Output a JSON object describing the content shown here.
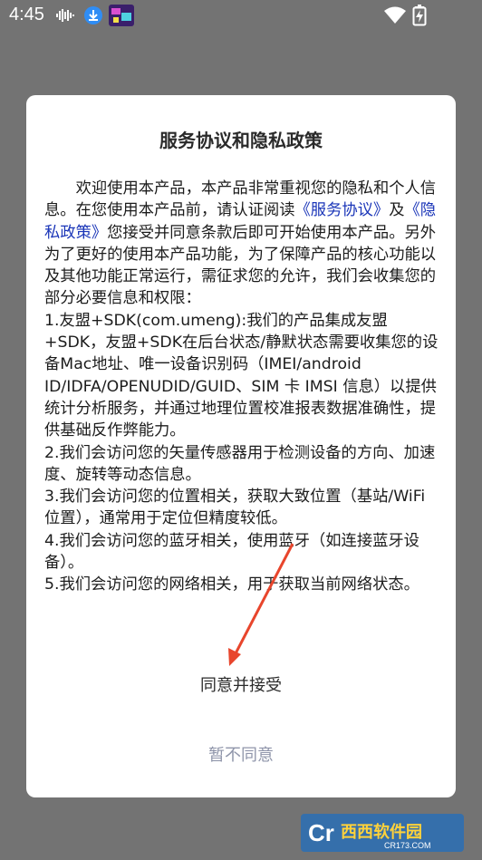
{
  "status_bar": {
    "time": "4:45",
    "icons": [
      "wave-icon",
      "download-icon",
      "app-thumbnail-icon",
      "wifi-icon",
      "battery-icon"
    ]
  },
  "dialog": {
    "title": "服务协议和隐私政策",
    "intro_pre": "欢迎使用本产品，本产品非常重视您的隐私和个人信息。在您使用本产品前，请认证阅读",
    "service_link": "《服务协议》",
    "and_text": "及",
    "privacy_link": "《隐私政策》",
    "intro_post": "您接受并同意条款后即可开始使用本产品。另外为了更好的使用本产品功能，为了保障产品的核心功能以及其他功能正常运行，需征求您的允许，我们会收集您的部分必要信息和权限：",
    "items": [
      "1.友盟+SDK(com.umeng):我们的产品集成友盟+SDK，友盟+SDK在后台状态/静默状态需要收集您的设备Mac地址、唯一设备识别码（IMEI/android ID/IDFA/OPENUDID/GUID、SIM 卡 IMSI 信息）以提供统计分析服务，并通过地理位置校准报表数据准确性，提供基础反作弊能力。",
      "2.我们会访问您的矢量传感器用于检测设备的方向、加速度、旋转等动态信息。",
      "3.我们会访问您的位置相关，获取大致位置（基站/WiFi 位置），通常用于定位但精度较低。",
      "4.我们会访问您的蓝牙相关，使用蓝牙（如连接蓝牙设备）。",
      "5.我们会访问您的网络相关，用于获取当前网络状态。"
    ],
    "agree_label": "同意并接受",
    "disagree_label": "暂不同意"
  },
  "annotation": {
    "arrow_color": "#e8452c"
  },
  "watermark": {
    "brand": "西西软件园",
    "site": "CR173.COM"
  },
  "colors": {
    "overlay": "#737373",
    "link": "#1a35b8",
    "disagree": "#8f95aa"
  }
}
